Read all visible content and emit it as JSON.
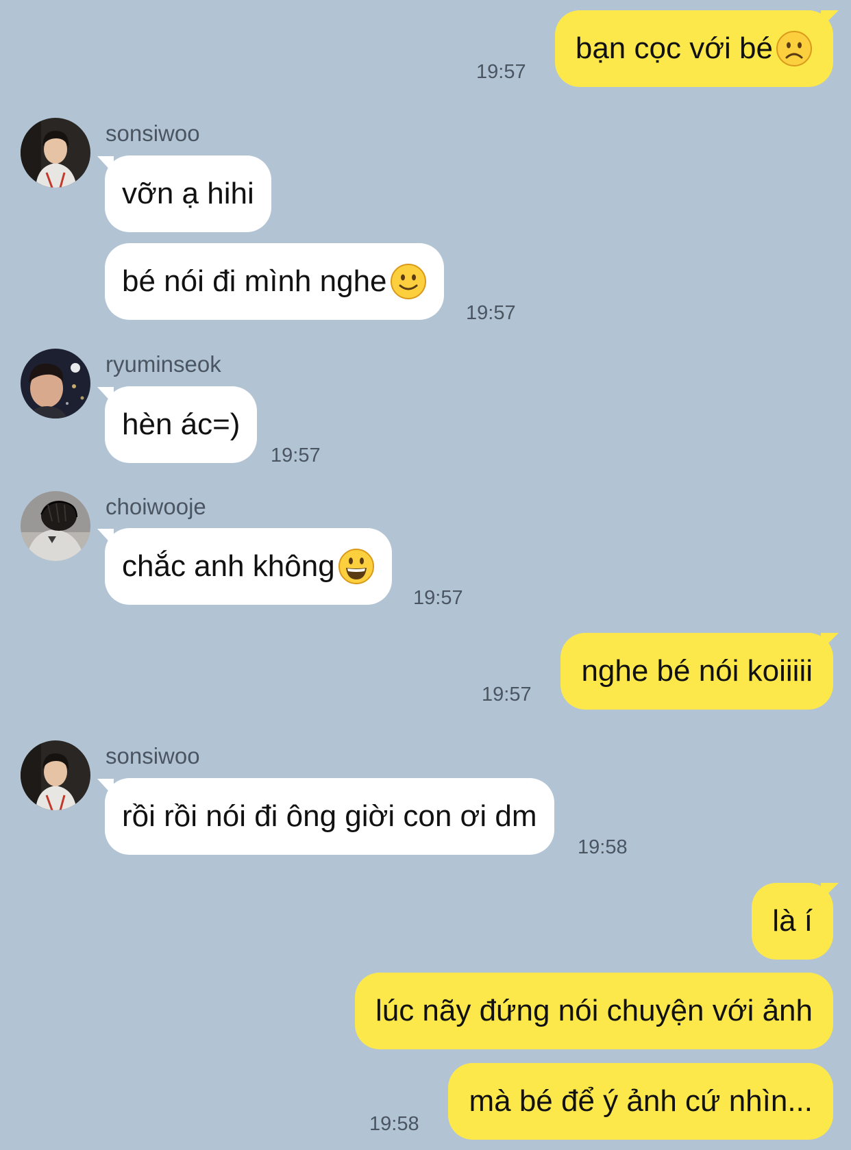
{
  "messages": [
    {
      "sender": "me",
      "text": "bạn cọc với bé",
      "emoji": "frowning-face",
      "time": "19:57"
    },
    {
      "sender": "sonsiwoo",
      "text": "vỡn ạ hihi"
    },
    {
      "sender": "sonsiwoo",
      "text": "bé nói đi mình nghe",
      "emoji": "slightly-smiling-face",
      "time": "19:57"
    },
    {
      "sender": "ryuminseok",
      "text": "hèn ác=)",
      "time": "19:57"
    },
    {
      "sender": "choiwooje",
      "text": "chắc anh không",
      "emoji": "grinning-face",
      "time": "19:57"
    },
    {
      "sender": "me",
      "text": "nghe bé nói koiiiii",
      "time": "19:57"
    },
    {
      "sender": "sonsiwoo",
      "text": "rồi rồi nói đi ông giời con ơi dm",
      "time": "19:58"
    },
    {
      "sender": "me",
      "text": "là í"
    },
    {
      "sender": "me",
      "text": "lúc nãy đứng nói chuyện với ảnh"
    },
    {
      "sender": "me",
      "text": "mà bé để ý ảnh cứ nhìn...",
      "time": "19:58"
    }
  ],
  "colors": {
    "background": "#b2c4d4",
    "outgoing_bubble": "#fce84b",
    "incoming_bubble": "#ffffff",
    "meta_text": "#4a5561"
  }
}
